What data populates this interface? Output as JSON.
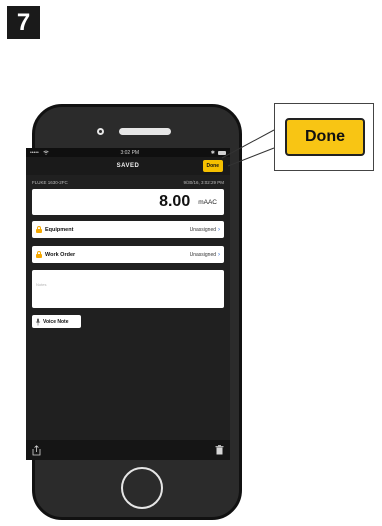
{
  "step_number": "7",
  "status_bar": {
    "time": "3:02 PM",
    "carrier": "•••••"
  },
  "nav": {
    "title": "SAVED",
    "done_label": "Done"
  },
  "measurement": {
    "device": "FLUKE 1630-2FC",
    "timestamp": "9/30/16, 3:02:29 PM",
    "value": "8.00",
    "unit": "mAAC"
  },
  "fields": [
    {
      "label": "Equipment",
      "value": "Unassigned"
    },
    {
      "label": "Work Order",
      "value": "Unassigned"
    }
  ],
  "notes": {
    "placeholder": "Notes"
  },
  "voice_note": {
    "label": "Voice Note"
  },
  "callout": {
    "label": "Done"
  },
  "colors": {
    "accent": "#f5c000",
    "screen_bg": "#202020",
    "phone_body": "#2b2b2b"
  }
}
